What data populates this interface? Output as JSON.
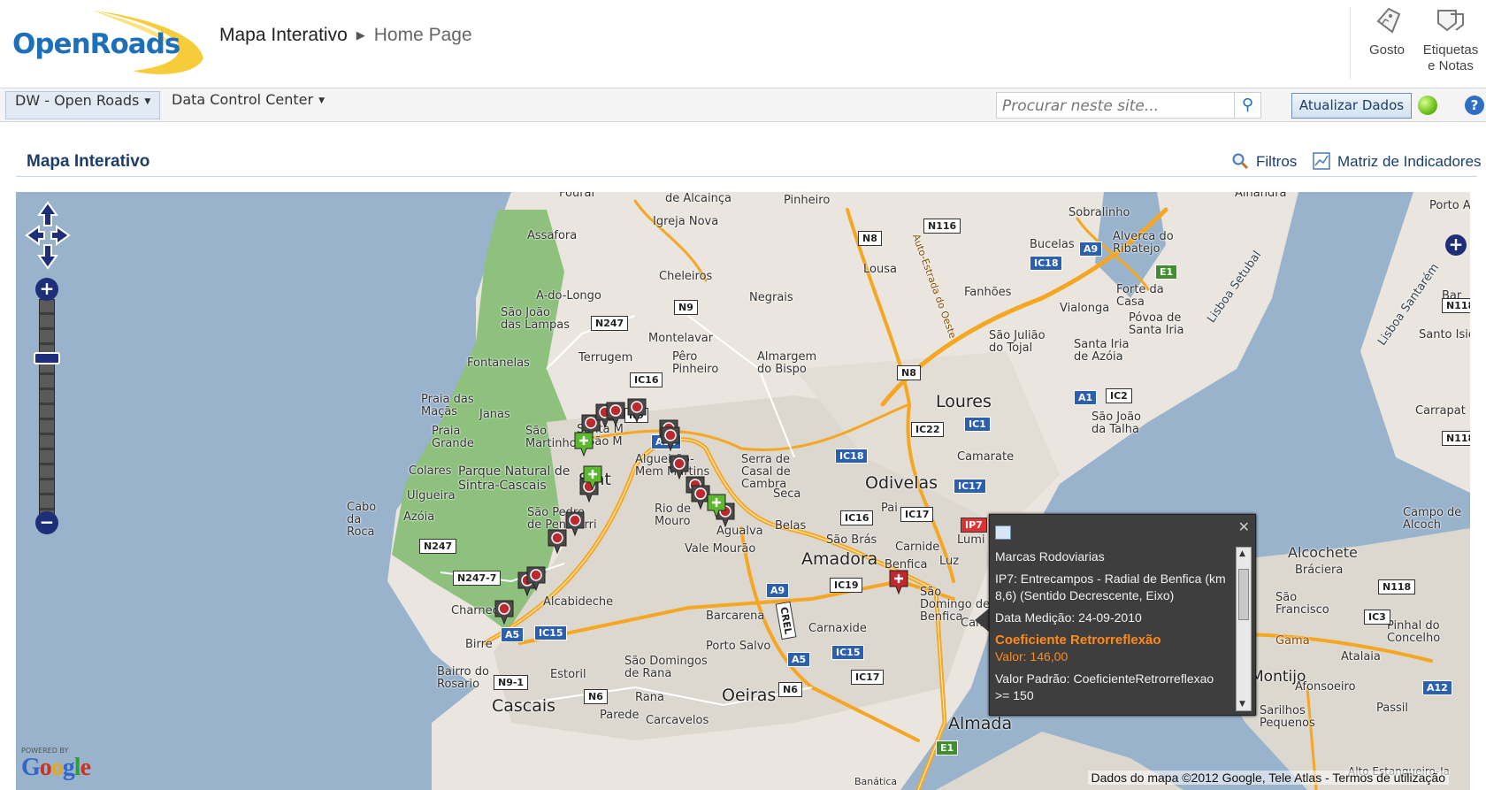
{
  "header": {
    "logo_text": "OpenRoads",
    "breadcrumb": {
      "site": "Mapa Interativo",
      "current": "Home Page"
    },
    "actions": [
      {
        "label": "Gosto",
        "icon": "thumbs-up-tag-icon"
      },
      {
        "label": "Etiquetas e Notas",
        "icon": "tag-notes-icon"
      }
    ]
  },
  "navbar": {
    "items": [
      {
        "label": "DW - Open Roads",
        "active": true
      },
      {
        "label": "Data Control Center",
        "active": false
      }
    ],
    "search_placeholder": "Procurar neste site...",
    "update_button": "Atualizar Dados",
    "status_color": "#6cbf1b"
  },
  "page": {
    "title": "Mapa Interativo",
    "tools": [
      {
        "label": "Filtros",
        "icon": "magnifier-icon"
      },
      {
        "label": "Matriz de Indicadores",
        "icon": "chart-matrix-icon"
      }
    ]
  },
  "map": {
    "places": [
      {
        "name": "de Alcainça",
        "big": false
      },
      {
        "name": "Igreja Nova",
        "big": false
      },
      {
        "name": "Pinheiro",
        "big": false
      },
      {
        "name": "Sobralinho",
        "big": false
      },
      {
        "name": "Alverca do Ribatejo",
        "big": false
      },
      {
        "name": "Assafora",
        "big": false
      },
      {
        "name": "Cheleiros",
        "big": false
      },
      {
        "name": "Negrais",
        "big": false
      },
      {
        "name": "Lousa",
        "big": false
      },
      {
        "name": "Bucelas",
        "big": false
      },
      {
        "name": "A-do-Longo",
        "big": false
      },
      {
        "name": "São João das Lampas",
        "big": false
      },
      {
        "name": "Fanhões",
        "big": false
      },
      {
        "name": "Vialonga",
        "big": false
      },
      {
        "name": "Forte da Casa",
        "big": false
      },
      {
        "name": "Póvoa de Santa Iria",
        "big": false
      },
      {
        "name": "Montelavar",
        "big": false
      },
      {
        "name": "Fontanelas",
        "big": false
      },
      {
        "name": "Terrugem",
        "big": false
      },
      {
        "name": "Pêro Pinheiro",
        "big": false
      },
      {
        "name": "Almargem do Bispo",
        "big": false
      },
      {
        "name": "São Julião do Tojal",
        "big": false
      },
      {
        "name": "Santa Iria de Azóia",
        "big": false
      },
      {
        "name": "Loures",
        "big": true
      },
      {
        "name": "Praia das Maçãs",
        "big": false
      },
      {
        "name": "Janas",
        "big": false
      },
      {
        "name": "São João da Talha",
        "big": false
      },
      {
        "name": "Praia Grande",
        "big": false
      },
      {
        "name": "São Martinho",
        "big": false
      },
      {
        "name": "Santa M e São M",
        "big": false
      },
      {
        "name": "Colares",
        "big": false
      },
      {
        "name": "Parque Natural de Sintra-Cascais",
        "big": false
      },
      {
        "name": "Algueirão-Mem Martins",
        "big": false
      },
      {
        "name": "Serra de Casal de Cambra",
        "big": false
      },
      {
        "name": "Camarate",
        "big": false
      },
      {
        "name": "Sint",
        "big": true
      },
      {
        "name": "Odivelas",
        "big": true
      },
      {
        "name": "Ulgueira",
        "big": false
      },
      {
        "name": "Seca",
        "big": false
      },
      {
        "name": "Cabo da Roca",
        "big": false
      },
      {
        "name": "Azóia",
        "big": false
      },
      {
        "name": "São Pedro de Penaferri",
        "big": false
      },
      {
        "name": "Rio de Mouro",
        "big": false
      },
      {
        "name": "Agualva",
        "big": false
      },
      {
        "name": "Pai",
        "big": false
      },
      {
        "name": "Belas",
        "big": false
      },
      {
        "name": "São Brás",
        "big": false
      },
      {
        "name": "Carnide",
        "big": false
      },
      {
        "name": "Lumi",
        "big": false
      },
      {
        "name": "Vale Mourão",
        "big": false
      },
      {
        "name": "Amadora",
        "big": true
      },
      {
        "name": "Benfica",
        "big": false
      },
      {
        "name": "Luz",
        "big": false
      },
      {
        "name": "São Domingo de Benfica",
        "big": false
      },
      {
        "name": "Campolid",
        "big": false
      },
      {
        "name": "Charneca",
        "big": false
      },
      {
        "name": "Alcabideche",
        "big": false
      },
      {
        "name": "Barcarena",
        "big": false
      },
      {
        "name": "Carnaxide",
        "big": false
      },
      {
        "name": "Birre",
        "big": false
      },
      {
        "name": "Porto Salvo",
        "big": false
      },
      {
        "name": "São Domingos de Rana",
        "big": false
      },
      {
        "name": "Bairro do Rosario",
        "big": false
      },
      {
        "name": "Estoril",
        "big": false
      },
      {
        "name": "Cascais",
        "big": true
      },
      {
        "name": "Rana",
        "big": false
      },
      {
        "name": "Oeiras",
        "big": true
      },
      {
        "name": "Parede",
        "big": false
      },
      {
        "name": "Carcavelos",
        "big": false
      },
      {
        "name": "Almada",
        "big": true
      },
      {
        "name": "Alcochete",
        "big": true
      },
      {
        "name": "Bráciera",
        "big": false
      },
      {
        "name": "São Francisco",
        "big": false
      },
      {
        "name": "Pinhal do Concelho",
        "big": false
      },
      {
        "name": "Montijo",
        "big": true
      },
      {
        "name": "Afonsoeiro",
        "big": false
      },
      {
        "name": "Atalaia",
        "big": false
      },
      {
        "name": "Passil",
        "big": false
      },
      {
        "name": "Sarilhos Pequenos",
        "big": false
      },
      {
        "name": "Campo de Alcoch",
        "big": false
      },
      {
        "name": "Carrapat",
        "big": false
      },
      {
        "name": "Santo Isid",
        "big": false
      },
      {
        "name": "Bar",
        "big": false
      },
      {
        "name": "Porto Al",
        "big": false
      },
      {
        "name": "Lisboa Setubal",
        "big": false
      },
      {
        "name": "Lisboa Santarém",
        "big": false
      },
      {
        "name": "Auto-Estrada do Oeste",
        "big": false
      },
      {
        "name": "Gama",
        "big": false
      },
      {
        "name": "Banática",
        "big": false
      },
      {
        "name": "Alto Estanqueiro-Ja",
        "big": false
      },
      {
        "name": "Fourai",
        "big": false
      },
      {
        "name": "Alhandra",
        "big": false
      }
    ],
    "shields": [
      {
        "label": "N116",
        "kind": "white"
      },
      {
        "label": "N8",
        "kind": "white"
      },
      {
        "label": "A9",
        "kind": "blue"
      },
      {
        "label": "IC18",
        "kind": "blue"
      },
      {
        "label": "E1",
        "kind": "green"
      },
      {
        "label": "N9",
        "kind": "white"
      },
      {
        "label": "N247",
        "kind": "white"
      },
      {
        "label": "IC16",
        "kind": "white"
      },
      {
        "label": "N8",
        "kind": "white"
      },
      {
        "label": "A1",
        "kind": "blue"
      },
      {
        "label": "IC2",
        "kind": "white"
      },
      {
        "label": "IC1",
        "kind": "blue"
      },
      {
        "label": "IC22",
        "kind": "white"
      },
      {
        "label": "N9",
        "kind": "white"
      },
      {
        "label": "A16",
        "kind": "blue"
      },
      {
        "label": "IC18",
        "kind": "blue"
      },
      {
        "label": "IC17",
        "kind": "blue"
      },
      {
        "label": "IC16",
        "kind": "white"
      },
      {
        "label": "IC17",
        "kind": "white"
      },
      {
        "label": "IP7",
        "kind": "white"
      },
      {
        "label": "N247",
        "kind": "white"
      },
      {
        "label": "N247-7",
        "kind": "white"
      },
      {
        "label": "A9",
        "kind": "blue"
      },
      {
        "label": "IC19",
        "kind": "white"
      },
      {
        "label": "A5",
        "kind": "blue"
      },
      {
        "label": "IC15",
        "kind": "blue"
      },
      {
        "label": "IC15",
        "kind": "blue"
      },
      {
        "label": "A5",
        "kind": "blue"
      },
      {
        "label": "N9-1",
        "kind": "white"
      },
      {
        "label": "N6",
        "kind": "white"
      },
      {
        "label": "N6",
        "kind": "white"
      },
      {
        "label": "IC17",
        "kind": "white"
      },
      {
        "label": "E1",
        "kind": "green"
      },
      {
        "label": "N118",
        "kind": "white"
      },
      {
        "label": "IC3",
        "kind": "white"
      },
      {
        "label": "A12",
        "kind": "blue"
      },
      {
        "label": "N118",
        "kind": "white"
      },
      {
        "label": "N118",
        "kind": "white"
      },
      {
        "label": "CREL",
        "kind": "white"
      }
    ],
    "popup": {
      "layer": "Marcas Rodoviarias",
      "location": "IP7: Entrecampos - Radial de Benfica (km 8,6) (Sentido Decrescente, Eixo)",
      "date": "Data Medição: 24-09-2010",
      "indicator": "Coeficiente Retrorreflexão",
      "value": "Valor: 146,00",
      "standard": "Valor Padrão: CoeficienteRetrorreflexao >= 150"
    },
    "google": {
      "powered": "POWERED BY",
      "name": "Google"
    },
    "attribution": "Dados do mapa ©2012 Google, Tele Atlas - Termos de utilização",
    "colors": {
      "sea": "#99b3cc",
      "land": "#eae6df",
      "park": "#8dc17d",
      "urban": "#dcd8cf",
      "highway": "#f5a623",
      "marker_red": "#c0282d",
      "marker_dark": "#4a4a4a",
      "marker_green": "#5cb82e"
    }
  }
}
